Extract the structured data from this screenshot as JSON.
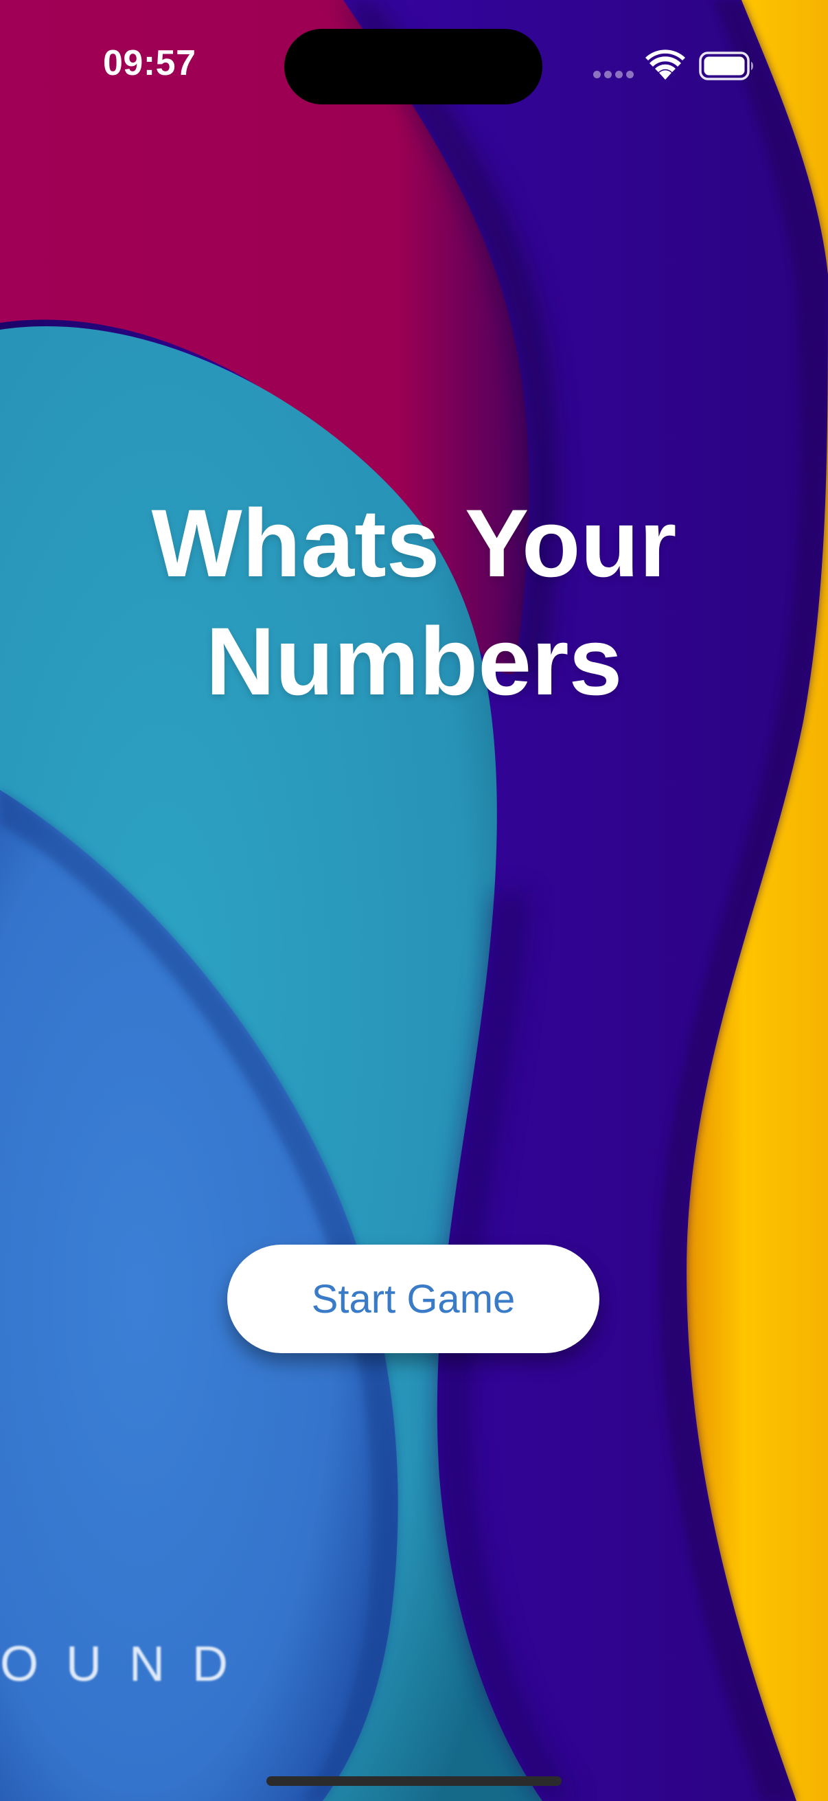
{
  "status_bar": {
    "time": "09:57",
    "icons": [
      "cellular-signal-icon",
      "wifi-icon",
      "battery-icon"
    ]
  },
  "title": {
    "line1": "Whats Your",
    "line2": "Numbers"
  },
  "start_button": {
    "label": "Start Game"
  },
  "watermark": {
    "text": "OUND"
  },
  "colors": {
    "magenta": "#a10050",
    "teal": "#2a9cbc",
    "blue": "#3876cf",
    "indigo": "#32039a",
    "yellow": "#fbbb02",
    "button_text": "#3a7bc8",
    "button_bg": "#ffffff"
  }
}
